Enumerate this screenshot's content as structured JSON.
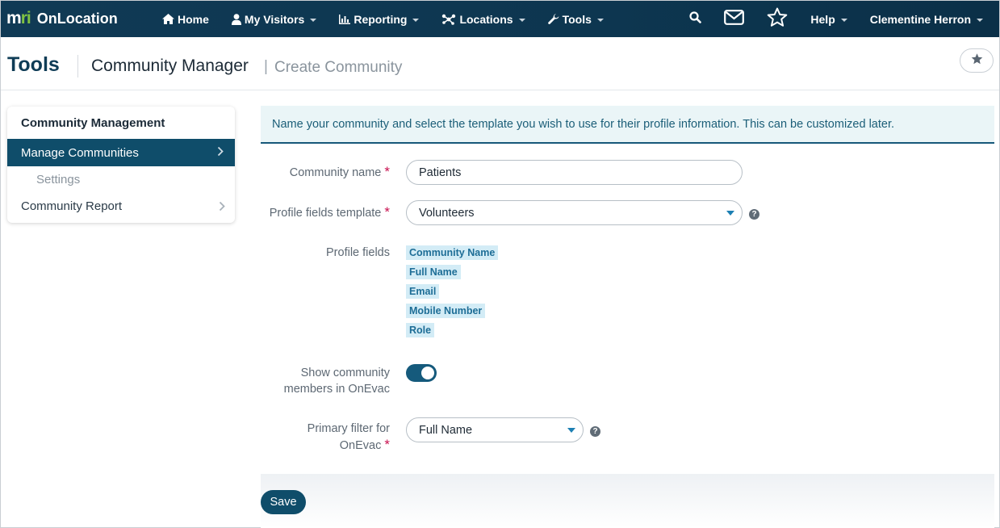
{
  "brand": {
    "mark_prefix": "m",
    "mark_suffix": "ri",
    "name": "OnLocation"
  },
  "nav": {
    "items": [
      {
        "label": "Home",
        "icon": "home-icon",
        "has_caret": false
      },
      {
        "label": "My Visitors",
        "icon": "user-icon",
        "has_caret": true
      },
      {
        "label": "Reporting",
        "icon": "bar-chart-icon",
        "has_caret": true
      },
      {
        "label": "Locations",
        "icon": "network-icon",
        "has_caret": true
      },
      {
        "label": "Tools",
        "icon": "wrench-icon",
        "has_caret": true
      }
    ],
    "help_label": "Help",
    "user_name": "Clementine Herron"
  },
  "header": {
    "section": "Tools",
    "title": "Community Manager",
    "separator": "|",
    "subtitle": "Create Community"
  },
  "sidebar": {
    "heading": "Community Management",
    "items": [
      {
        "label": "Manage Communities",
        "active": true
      },
      {
        "label": "Settings",
        "sub": true
      },
      {
        "label": "Community Report",
        "active": false
      }
    ]
  },
  "form": {
    "banner": "Name your community and select the template you wish to use for their profile information. This can be customized later.",
    "community_name_label": "Community name",
    "community_name_value": "Patients",
    "template_label": "Profile fields template",
    "template_value": "Volunteers",
    "profile_fields_label": "Profile fields",
    "profile_fields": [
      "Community Name",
      "Full Name",
      "Email",
      "Mobile Number",
      "Role"
    ],
    "show_members_label_line1": "Show community",
    "show_members_label_line2": "members in OnEvac",
    "show_members_enabled": true,
    "primary_filter_label_line1": "Primary filter for",
    "primary_filter_label_line2": "OnEvac",
    "primary_filter_value": "Full Name",
    "required_mark": "*",
    "help_mark": "?",
    "save_label": "Save"
  },
  "colors": {
    "nav_bg": "#103a55",
    "accent": "#0f4d6a",
    "brand_green": "#7fc242",
    "required": "#c8104f",
    "tag_bg": "#d3ecf6"
  }
}
